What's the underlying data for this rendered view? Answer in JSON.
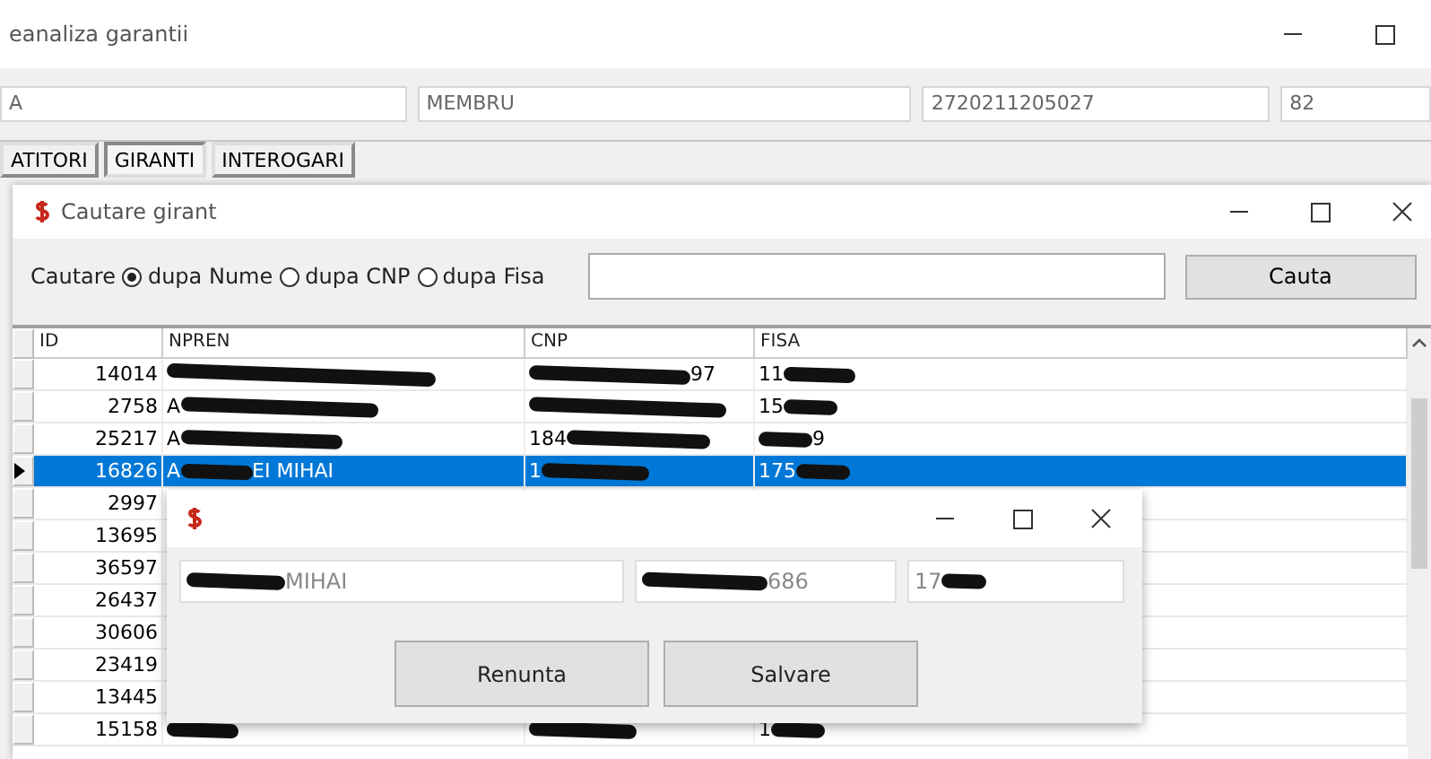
{
  "main_window": {
    "title": "eanaliza garantii",
    "fields": [
      "A",
      "MEMBRU",
      "2720211205027",
      "82"
    ],
    "tabs": [
      {
        "label": "ATITORI",
        "selected": false
      },
      {
        "label": "GIRANTI",
        "selected": true
      },
      {
        "label": "INTEROGARI",
        "selected": false
      }
    ]
  },
  "search_window": {
    "title": "Cautare girant",
    "search_label": "Cautare",
    "radios": [
      {
        "label": "dupa Nume",
        "selected": true
      },
      {
        "label": "dupa CNP",
        "selected": false
      },
      {
        "label": "dupa Fisa",
        "selected": false
      }
    ],
    "search_button": "Cauta",
    "table": {
      "columns": [
        "ID",
        "NPREN",
        "CNP",
        "FISA"
      ],
      "rows": [
        {
          "id": "14014",
          "selected": false,
          "name": {
            "redacted": true
          },
          "cnp": {
            "redacted": true,
            "after": "97"
          },
          "fisa": {
            "before": "11",
            "redacted": true
          }
        },
        {
          "id": "2758",
          "selected": false,
          "name": {
            "before": "A",
            "redacted": true
          },
          "cnp": {
            "redacted": true
          },
          "fisa": {
            "before": "15",
            "redacted": true
          }
        },
        {
          "id": "25217",
          "selected": false,
          "name": {
            "before": "A",
            "redacted": true
          },
          "cnp": {
            "before": "184",
            "redacted": true
          },
          "fisa": {
            "redacted": true,
            "after": "9"
          }
        },
        {
          "id": "16826",
          "selected": true,
          "name": {
            "before": "A",
            "redacted": true,
            "after": "EI MIHAI"
          },
          "cnp": {
            "before": "1",
            "redacted": true
          },
          "fisa": {
            "before": "175",
            "redacted": true
          }
        },
        {
          "id": "2997",
          "selected": false
        },
        {
          "id": "13695",
          "selected": false
        },
        {
          "id": "36597",
          "selected": false
        },
        {
          "id": "26437",
          "selected": false
        },
        {
          "id": "30606",
          "selected": false
        },
        {
          "id": "23419",
          "selected": false
        },
        {
          "id": "13445",
          "selected": false
        },
        {
          "id": "15158",
          "selected": false,
          "name": {
            "redacted": true
          },
          "cnp": {
            "redacted": true
          },
          "fisa": {
            "before": "1",
            "redacted": true
          }
        }
      ]
    }
  },
  "edit_dialog": {
    "fields": [
      {
        "redacted": true,
        "after": "MIHAI"
      },
      {
        "redacted": true,
        "after": "686"
      },
      {
        "before": "17",
        "redacted": true
      }
    ],
    "buttons": [
      "Renunta",
      "Salvare"
    ]
  }
}
